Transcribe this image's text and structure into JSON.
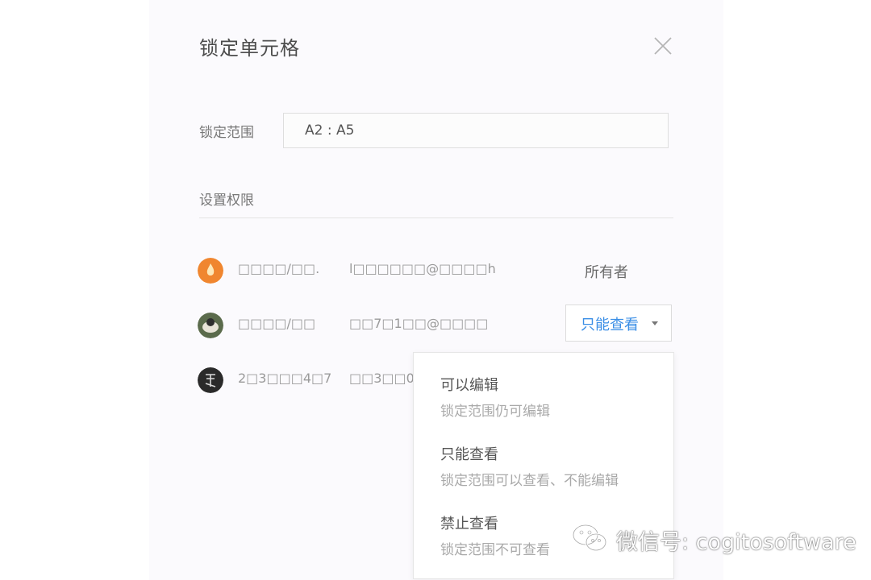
{
  "dialog": {
    "title": "锁定单元格",
    "close_icon": "close-icon"
  },
  "range": {
    "label": "锁定范围",
    "value": "A2 : A5"
  },
  "permissions": {
    "label": "设置权限",
    "users": [
      {
        "avatar_icon": "flame-avatar",
        "name": "□□□□/□□.",
        "email": "l□□□□□□@□□□□h",
        "role": "所有者"
      },
      {
        "avatar_icon": "photo-avatar",
        "name": "□□□□/□□",
        "email": "□□7□1□□@□□□□",
        "role": "只能查看"
      },
      {
        "avatar_icon": "calligraphy-avatar",
        "name": "2□3□□□4□7",
        "email": "□□3□□0□"
      }
    ]
  },
  "dropdown": {
    "options": [
      {
        "title": "可以编辑",
        "desc": "锁定范围仍可编辑"
      },
      {
        "title": "只能查看",
        "desc": "锁定范围可以查看、不能编辑"
      },
      {
        "title": "禁止查看",
        "desc": "锁定范围不可查看"
      }
    ]
  },
  "watermark": {
    "text": "微信号: cogitosoftware",
    "icon": "wechat-icon"
  },
  "colors": {
    "accent": "#3a8ee6",
    "dialog_bg": "#fbfafd",
    "owner_avatar": "#f0862f"
  }
}
